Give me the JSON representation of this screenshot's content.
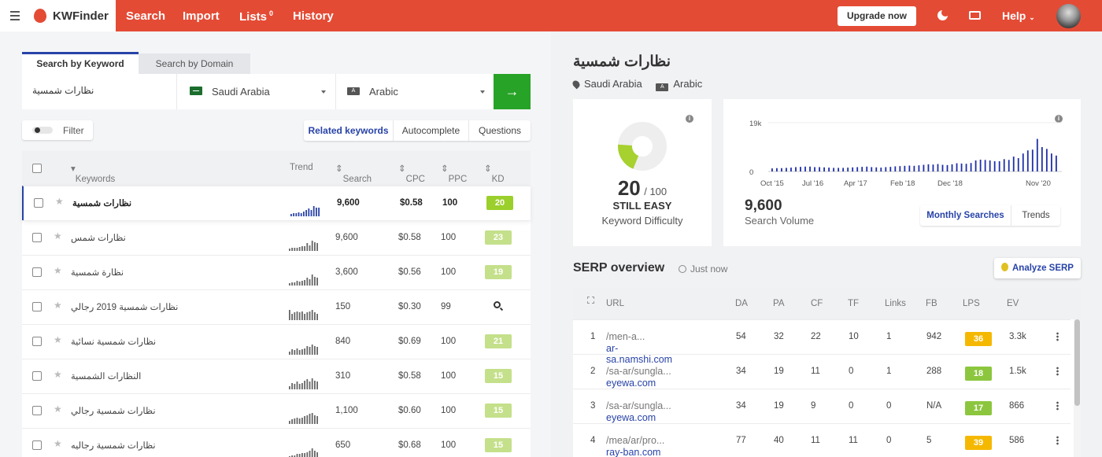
{
  "app": {
    "name": "KWFinder"
  },
  "nav": {
    "items": [
      {
        "label": "Search"
      },
      {
        "label": "Import"
      },
      {
        "label": "Lists",
        "badge": "0"
      },
      {
        "label": "History"
      }
    ],
    "upgrade": "Upgrade now",
    "help": "Help"
  },
  "search": {
    "tabs": [
      "Search by Keyword",
      "Search by Domain"
    ],
    "keyword": "نظارات شمسية",
    "location": "Saudi Arabia",
    "language": "Arabic",
    "go": "→"
  },
  "filter": {
    "label": "Filter"
  },
  "modes": [
    "Related keywords",
    "Autocomplete",
    "Questions"
  ],
  "table": {
    "headers": {
      "keywords": "Keywords",
      "trend": "Trend",
      "search": "Search",
      "cpc": "CPC",
      "ppc": "PPC",
      "kd": "KD"
    },
    "rows": [
      {
        "kw": "نظارات شمسية",
        "search": "9,600",
        "cpc": "$0.58",
        "ppc": "100",
        "kd": "20",
        "kdColor": "#9bcf2b",
        "bold": true,
        "trend": [
          0.2,
          0.3,
          0.25,
          0.35,
          0.3,
          0.4,
          0.55,
          0.7,
          0.6,
          0.95,
          0.75,
          0.8
        ]
      },
      {
        "kw": "نظارات شمس",
        "search": "9,600",
        "cpc": "$0.58",
        "ppc": "100",
        "kd": "23",
        "kdColor": "#c4e08a",
        "trend": [
          0.2,
          0.25,
          0.3,
          0.3,
          0.35,
          0.4,
          0.45,
          0.7,
          0.5,
          0.95,
          0.8,
          0.7
        ]
      },
      {
        "kw": "نظارة شمسية",
        "search": "3,600",
        "cpc": "$0.56",
        "ppc": "100",
        "kd": "19",
        "kdColor": "#c4e08a",
        "trend": [
          0.2,
          0.3,
          0.3,
          0.4,
          0.35,
          0.4,
          0.5,
          0.7,
          0.6,
          1,
          0.8,
          0.7
        ]
      },
      {
        "kw": "نظارات شمسية 2019 رجالي",
        "search": "150",
        "cpc": "$0.30",
        "ppc": "99",
        "kd": "",
        "kdColor": "",
        "trend": [
          0.9,
          0.6,
          0.7,
          0.8,
          0.7,
          0.8,
          0.6,
          0.7,
          0.8,
          0.9,
          0.7,
          0.6
        ]
      },
      {
        "kw": "نظارات شمسية نسائية",
        "search": "840",
        "cpc": "$0.69",
        "ppc": "100",
        "kd": "21",
        "kdColor": "#c4e08a",
        "trend": [
          0.3,
          0.5,
          0.4,
          0.6,
          0.4,
          0.5,
          0.6,
          0.8,
          0.7,
          0.9,
          0.8,
          0.7
        ]
      },
      {
        "kw": "النظارات الشمسية",
        "search": "310",
        "cpc": "$0.58",
        "ppc": "100",
        "kd": "15",
        "kdColor": "#c4e08a",
        "trend": [
          0.3,
          0.6,
          0.5,
          0.7,
          0.5,
          0.6,
          0.8,
          0.9,
          0.7,
          1,
          0.8,
          0.7
        ]
      },
      {
        "kw": "نظارات شمسية رجالي",
        "search": "1,100",
        "cpc": "$0.60",
        "ppc": "100",
        "kd": "15",
        "kdColor": "#c4e08a",
        "trend": [
          0.3,
          0.4,
          0.5,
          0.6,
          0.5,
          0.6,
          0.7,
          0.8,
          0.9,
          1,
          0.8,
          0.7
        ]
      },
      {
        "kw": "نظارات شمسية رجاليه",
        "search": "650",
        "cpc": "$0.68",
        "ppc": "100",
        "kd": "15",
        "kdColor": "#c4e08a",
        "trend": [
          0.2,
          0.3,
          0.3,
          0.4,
          0.4,
          0.5,
          0.5,
          0.6,
          0.7,
          0.9,
          0.7,
          0.6
        ]
      }
    ]
  },
  "detail": {
    "title": "نظارات شمسية",
    "location": "Saudi Arabia",
    "language": "Arabic",
    "kd": {
      "value": "20",
      "max": "/ 100",
      "label": "STILL EASY",
      "caption": "Keyword Difficulty",
      "fraction": 0.2
    },
    "volume": {
      "value": "9,600",
      "caption": "Search Volume",
      "ymax": "19k",
      "ymin": "0",
      "xlabels": [
        "Oct '15",
        "Jul '16",
        "Apr '17",
        "Feb '18",
        "Dec '18",
        "Nov '20"
      ],
      "btn_monthly": "Monthly Searches",
      "btn_trends": "Trends"
    }
  },
  "chart_data": {
    "type": "bar",
    "title": "",
    "xlabel": "",
    "ylabel": "",
    "ylim": [
      0,
      19000
    ],
    "series": [
      {
        "values": [
          1200,
          1300,
          1300,
          1400,
          1500,
          1700,
          1800,
          1900,
          1900,
          1700,
          1700,
          1600,
          1500,
          1400,
          1400,
          1400,
          1500,
          1600,
          1700,
          1800,
          1900,
          1700,
          1600,
          1500,
          1700,
          1800,
          2000,
          2100,
          2200,
          2300,
          2200,
          2400,
          2600,
          2800,
          2700,
          2900,
          2600,
          2500,
          2800,
          3200,
          3100,
          3000,
          3300,
          4300,
          4600,
          4500,
          4300,
          4000,
          4000,
          4800,
          4500,
          5800,
          5200,
          7000,
          8200,
          8500,
          12700,
          9500,
          8800,
          7000,
          6200
        ]
      }
    ]
  },
  "serp": {
    "title": "SERP overview",
    "updated": "Just now",
    "analyze": "Analyze SERP",
    "headers": {
      "url": "URL",
      "da": "DA",
      "pa": "PA",
      "cf": "CF",
      "tf": "TF",
      "links": "Links",
      "fb": "FB",
      "lps": "LPS",
      "ev": "EV"
    },
    "rows": [
      {
        "n": "1",
        "domain": "ar-sa.namshi.com",
        "path": "/men-a...",
        "da": "54",
        "pa": "32",
        "cf": "22",
        "tf": "10",
        "links": "1",
        "fb": "942",
        "lps": "36",
        "lpsColor": "#f5b800",
        "ev": "3.3k"
      },
      {
        "n": "2",
        "domain": "eyewa.com",
        "path": "/sa-ar/sungla...",
        "da": "34",
        "pa": "19",
        "cf": "11",
        "tf": "0",
        "links": "1",
        "fb": "288",
        "lps": "18",
        "lpsColor": "#8cc63e",
        "ev": "1.5k"
      },
      {
        "n": "3",
        "domain": "eyewa.com",
        "path": "/sa-ar/sungla...",
        "da": "34",
        "pa": "19",
        "cf": "9",
        "tf": "0",
        "links": "0",
        "fb": "N/A",
        "lps": "17",
        "lpsColor": "#8cc63e",
        "ev": "866"
      },
      {
        "n": "4",
        "domain": "ray-ban.com",
        "path": "/mea/ar/pro...",
        "da": "77",
        "pa": "40",
        "cf": "11",
        "tf": "11",
        "links": "0",
        "fb": "5",
        "lps": "39",
        "lpsColor": "#f5b800",
        "ev": "586"
      }
    ]
  }
}
